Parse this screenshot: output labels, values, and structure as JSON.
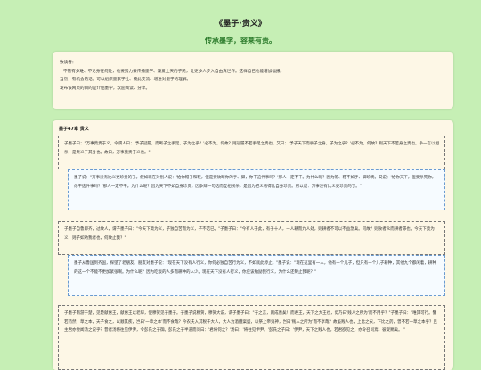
{
  "header": {
    "title": "《墨子·贵义》",
    "subtitle": "传承墨学，容莱有责。"
  },
  "intro": {
    "greeting": "致读者：",
    "lines": [
      "不管有多难、不论身在何处，也要努力去传播墨学、兼爱上天的子民，让更多人步入自由真世界。这样自己也能增加福报。",
      "当然，有机会的话，可以组织墨家学社、彼此交流、增进对墨学的理解。",
      "发布该网页的目的是介绍墨学，欢迎阅读、分享。"
    ]
  },
  "chapter": {
    "title": "墨子47章 贵义",
    "blocks": [
      {
        "kind": "orig",
        "text": "子墨子曰：\"万事莫贵于义。今谓人曰：'予子冠履，而断子之手足，子为之乎？'必不为。何故？则冠履不若手足之贵也。又曰：'予子天下而杀子之身，子为之乎？'必不为。何故？则天下不若身之贵也。争一言以相杀，是贵义于其身也。故曰，万事莫贵于义也。\""
      },
      {
        "kind": "trans",
        "text": "墨子说：\"万事没有比义更珍贵的了。假如现在对别人说：'给你帽子和鞋，但是要砍断你的手、脚，你干这件事吗？'那人一定不干。为什么呢？因为帽、鞋不如手、脚珍贵。又说：'给你天下，但要杀死你，你干这件事吗？'那人一定不干。为什么呢？因为天下不如自身珍贵。因争辩一句话而互相残杀，是因为把义看得比自身珍贵。所以说：万事没有比义更珍贵的了。\""
      },
      {
        "kind": "orig",
        "text": "子墨子自鲁即齐，过故人，谓子墨子曰：\"今天下莫为义，子独自苦而为义，子不若已。\"子墨子曰：\"今有人于此，有子十人，一人耕而九人处，则耕者不可以不益急矣。何故？则食者众而耕者寡也。今天下莫为义，则子如劝我者也，何故止我？\""
      },
      {
        "kind": "trans",
        "text": "墨子从鲁国到齐国，探望了老朋友。朋友对墨子说：\"现在天下没有人行义，你何必独自苦行为义，不如就此停止。\"墨子说：\"现在这里有一人，他有十个儿子，但只有一个儿子耕种，其他九个都闲着，耕种的这一个不能不更加紧张啊。为什么呢？因为吃饭的人多而耕种的人少。现在天下没有人行义，你应该勉励我行义，为什么还制止我呢？\""
      },
      {
        "kind": "orig",
        "text": "子墨子南游于楚，见楚献惠王，献惠王以老辞，使穆贺见子墨子。子墨子说穆贺，穆贺大说，谓子墨子曰：\"子之言，则成善矣！而君王，天下之大王也，毋乃曰'贱人之所为'而不用乎？\"子墨子曰：\"唯其可行。譬若药然，草之本，天子食之，以顺其疾，岂曰'一草之本'而不食哉？今农夫入其税于大人，大人为酒醴粢盛，以祭上帝鬼神，岂曰'贱人之所为'而不享哉？故虽贱人也，上比之农，下比之药，曾不若一草之本乎？且主君亦尝闻汤之说乎？昔者汤将往见伊尹，令彭氏之子御。彭氏之子半道而问曰：'君将何之？'汤曰：'将往见伊尹。'彭氏之子曰：'伊尹，天下之贱人也。若君欲见之，亦令召问焉，彼受赐矣。'\""
      }
    ]
  }
}
